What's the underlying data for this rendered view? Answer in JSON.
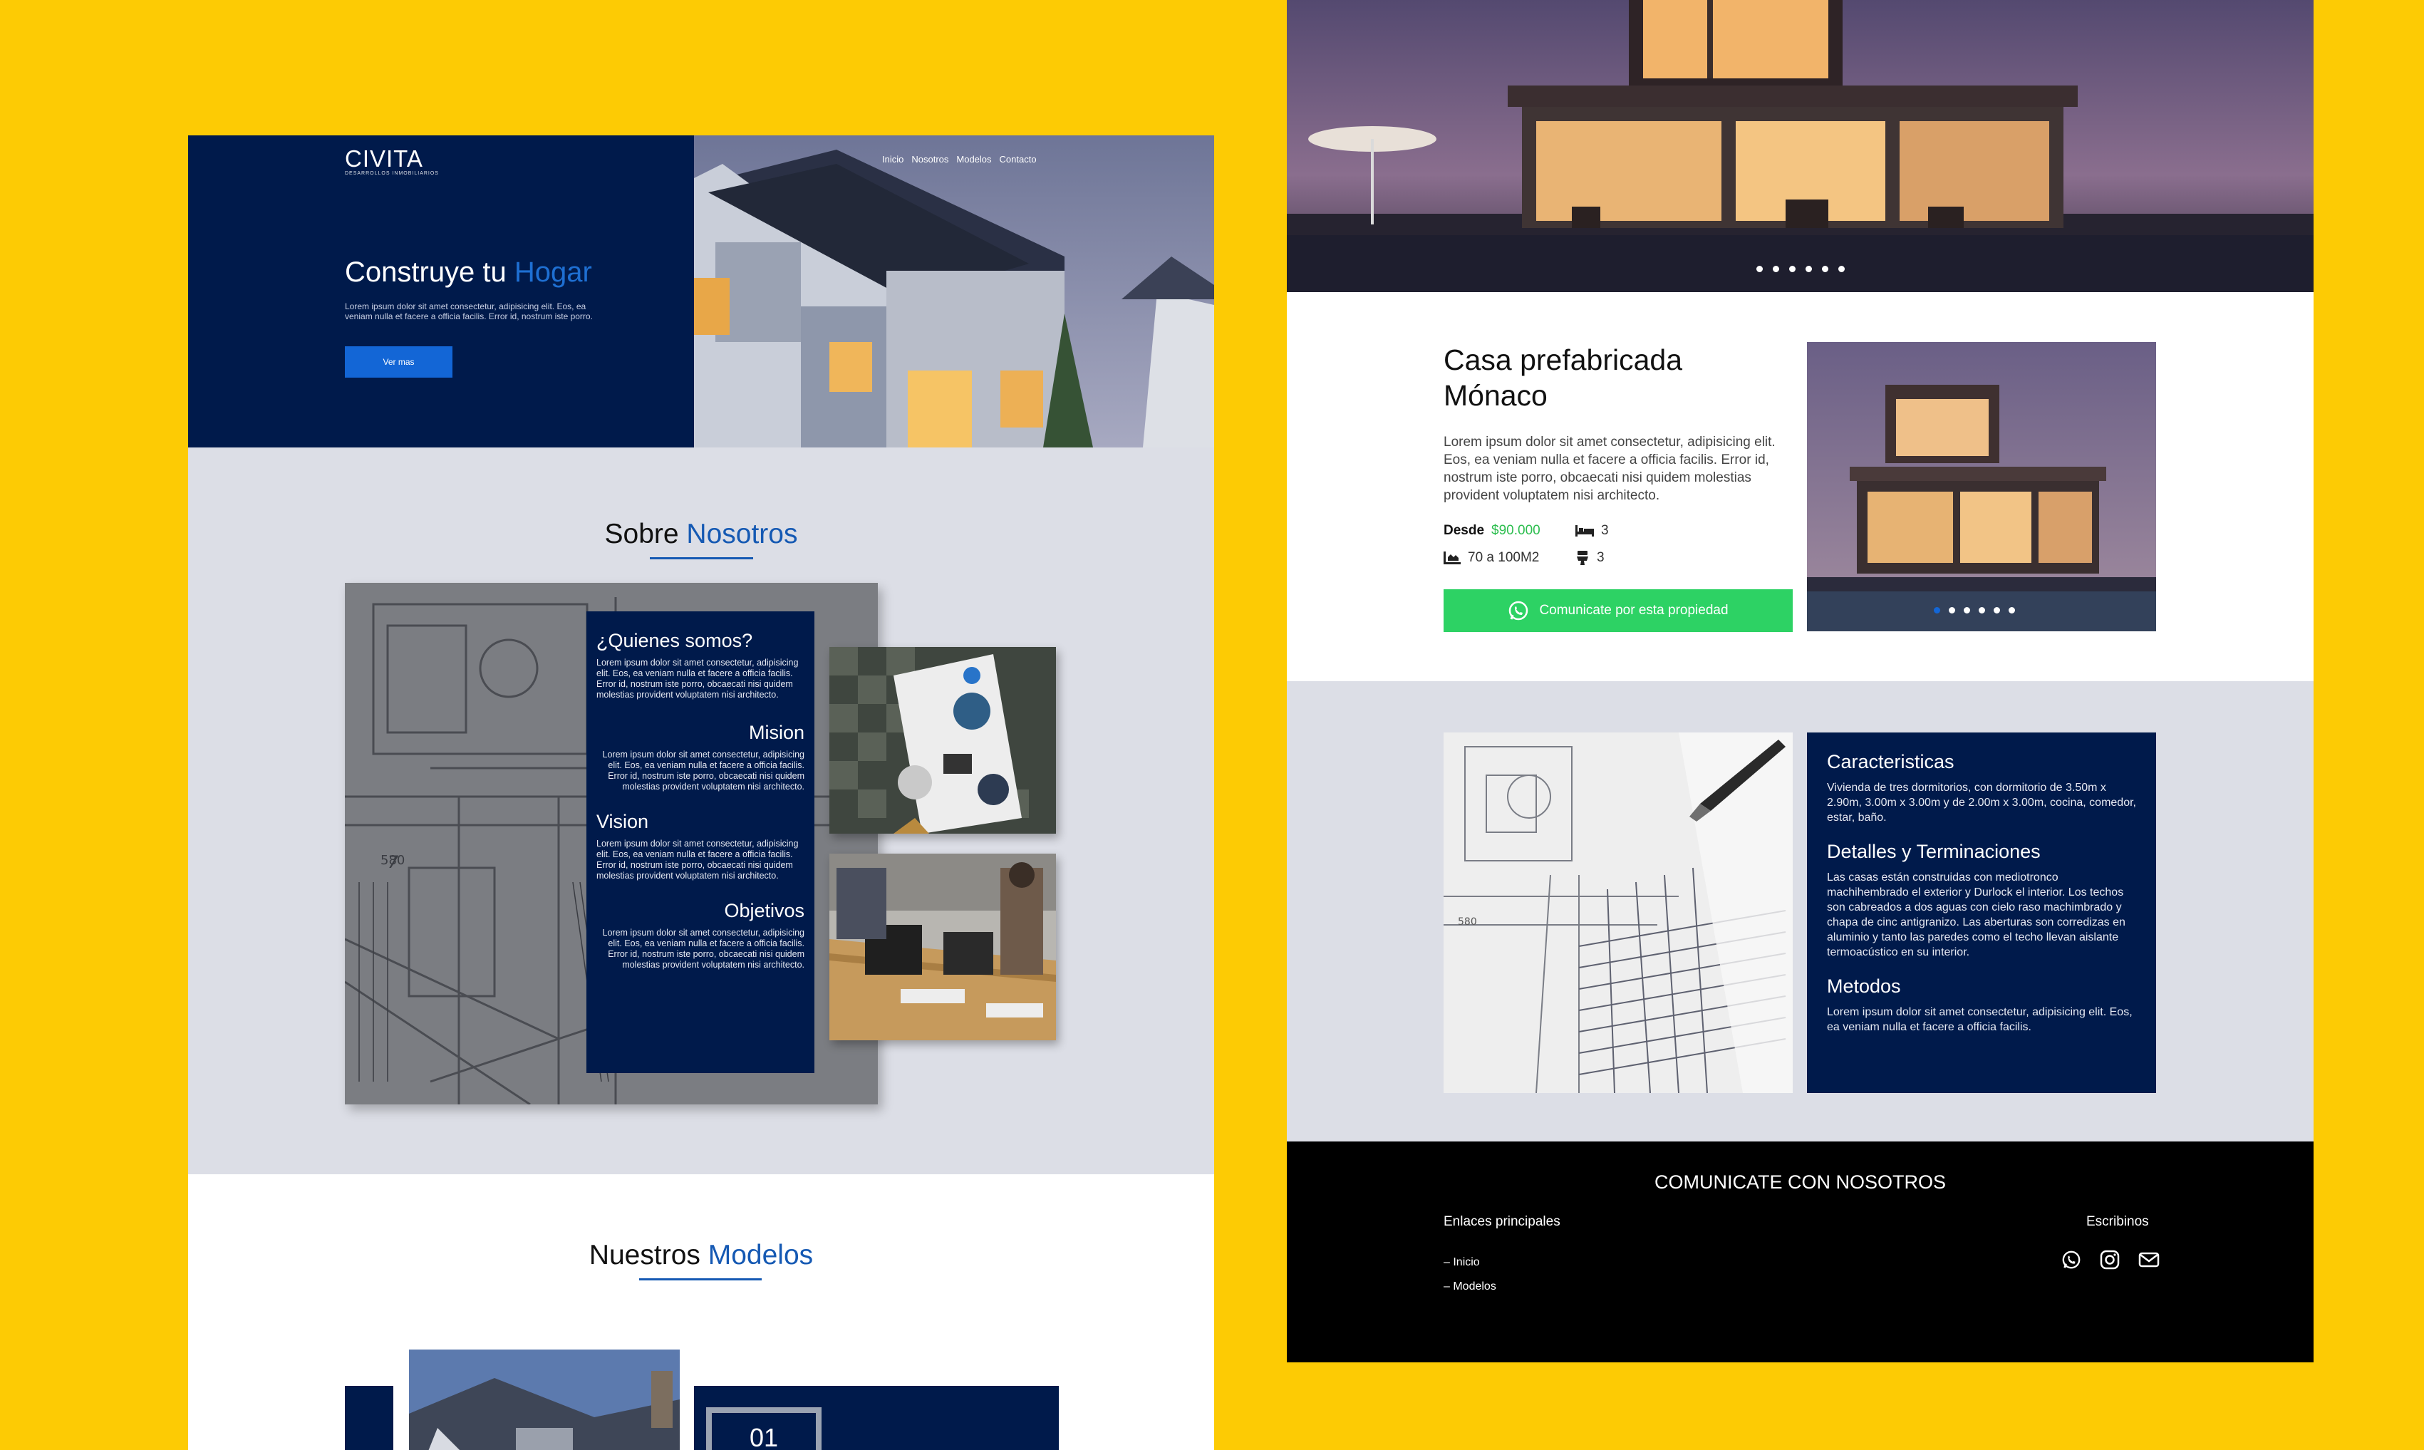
{
  "colors": {
    "background": "#FDCB04",
    "navy": "#001A4B",
    "accent_blue": "#1366D6",
    "green": "#2DD264",
    "gray_section": "#DCDEE6"
  },
  "left": {
    "brand": {
      "name": "CIVITA",
      "tagline": "DESARROLLOS INMOBILIARIOS"
    },
    "nav": [
      "Inicio",
      "Nosotros",
      "Modelos",
      "Contacto"
    ],
    "hero": {
      "title_a": "Construye tu ",
      "title_b": "Hogar",
      "lorem": "Lorem ipsum dolor sit amet consectetur, adipisicing elit. Eos, ea veniam nulla et facere a officia facilis. Error id, nostrum iste porro.",
      "button": "Ver mas"
    },
    "about": {
      "title_a": "Sobre ",
      "title_b": "Nosotros",
      "blocks": [
        {
          "heading": "¿Quienes somos?",
          "text": "Lorem ipsum dolor sit amet consectetur, adipisicing elit. Eos, ea veniam nulla et facere a officia facilis. Error id, nostrum iste porro, obcaecati nisi quidem molestias provident voluptatem nisi architecto."
        },
        {
          "heading": "Mision",
          "text": "Lorem ipsum dolor sit amet consectetur, adipisicing elit. Eos, ea veniam nulla et facere a officia facilis. Error id, nostrum iste porro, obcaecati nisi quidem molestias provident voluptatem nisi architecto."
        },
        {
          "heading": "Vision",
          "text": "Lorem ipsum dolor sit amet consectetur, adipisicing elit. Eos, ea veniam nulla et facere a officia facilis. Error id, nostrum iste porro, obcaecati nisi quidem molestias provident voluptatem nisi architecto."
        },
        {
          "heading": "Objetivos",
          "text": "Lorem ipsum dolor sit amet consectetur, adipisicing elit. Eos, ea veniam nulla et facere a officia facilis. Error id, nostrum iste porro, obcaecati nisi quidem molestias provident voluptatem nisi architecto."
        }
      ]
    },
    "models": {
      "title_a": "Nuestros ",
      "title_b": "Modelos",
      "number": "01"
    }
  },
  "right": {
    "slider_dots": 6,
    "casa": {
      "title": "Casa prefabricada Mónaco",
      "lorem": "Lorem ipsum dolor sit amet consectetur, adipisicing elit. Eos, ea veniam nulla et facere a officia facilis. Error id, nostrum iste porro, obcaecati nisi quidem molestias provident voluptatem nisi architecto.",
      "price_label": "Desde ",
      "price": "$90.000",
      "beds": "3",
      "area": "70 a 100M2",
      "baths": "3",
      "button": "Comunicate por esta propiedad"
    },
    "features": [
      {
        "heading": "Caracteristicas",
        "text": "Vivienda de tres dormitorios, con dormitorio de 3.50m x 2.90m, 3.00m x 3.00m y de 2.00m x 3.00m, cocina, comedor, estar, baño."
      },
      {
        "heading": "Detalles y Terminaciones",
        "text": "Las casas están construidas con mediotronco machihembrado el exterior y Durlock el interior. Los techos son cabreados a dos aguas con cielo raso machimbrado y chapa de cinc antigranizo. Las aberturas son corredizas en aluminio y tanto las paredes como el techo llevan aislante termoacústico en su interior."
      },
      {
        "heading": "Metodos",
        "text": "Lorem ipsum dolor sit amet consectetur, adipisicing elit. Eos, ea veniam nulla et facere a officia facilis."
      }
    ],
    "footer": {
      "title": "COMUNICATE CON NOSOTROS",
      "links_title": "Enlaces principales",
      "links": [
        "– Inicio",
        "– Modelos"
      ],
      "write_title": "Escribinos",
      "icons": [
        "whatsapp-icon",
        "instagram-icon",
        "mail-icon"
      ]
    }
  }
}
